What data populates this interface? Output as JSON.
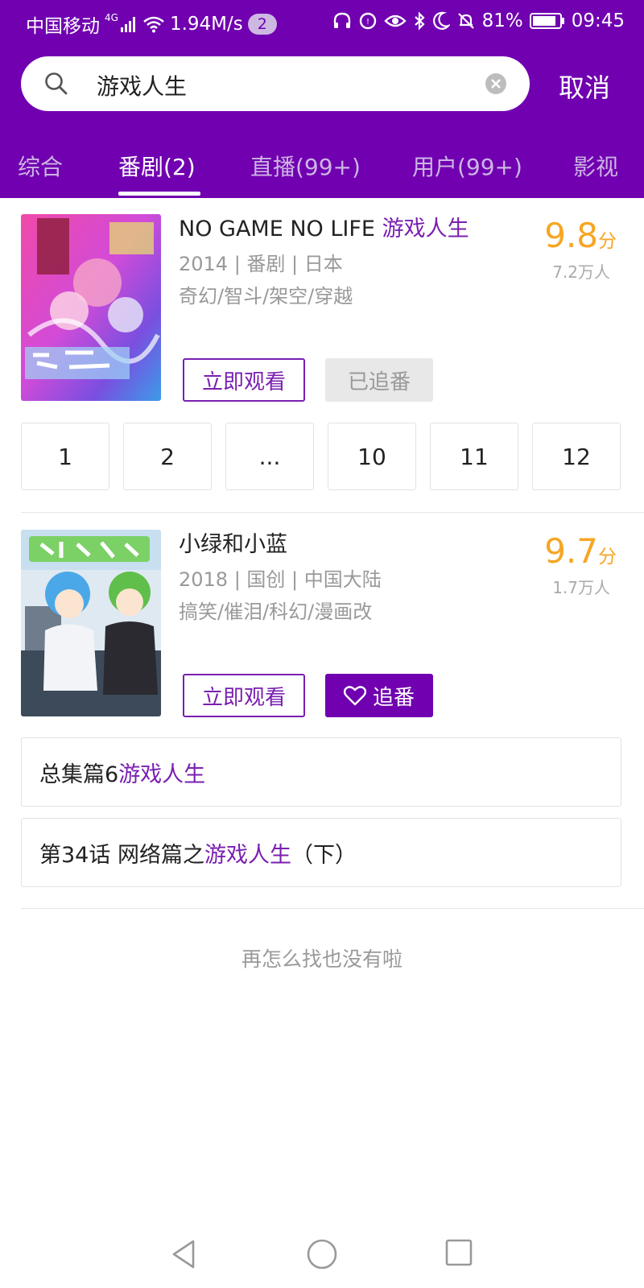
{
  "status_bar": {
    "carrier": "中国移动",
    "network": "4G",
    "speed": "1.94M/s",
    "notification_count": "2",
    "battery": "81%",
    "time": "09:45"
  },
  "search": {
    "query": "游戏人生",
    "cancel_label": "取消"
  },
  "tabs": [
    {
      "label": "综合"
    },
    {
      "label": "番剧(2)"
    },
    {
      "label": "直播(99+)"
    },
    {
      "label": "用户(99+)"
    },
    {
      "label": "影视"
    }
  ],
  "results": [
    {
      "title_prefix": "NO GAME NO LIFE ",
      "title_highlight": "游戏人生",
      "info": "2014 | 番剧 | 日本",
      "tags": "奇幻/智斗/架空/穿越",
      "score": "9.8",
      "score_unit": "分",
      "votes": "7.2万人",
      "watch_label": "立即观看",
      "follow_label": "已追番"
    },
    {
      "title_prefix": "小绿和小蓝",
      "title_highlight": "",
      "info": "2018 | 国创 | 中国大陆",
      "tags": "搞笑/催泪/科幻/漫画改",
      "score": "9.7",
      "score_unit": "分",
      "votes": "1.7万人",
      "watch_label": "立即观看",
      "follow_label": "追番"
    }
  ],
  "episodes": [
    "1",
    "2",
    "...",
    "10",
    "11",
    "12"
  ],
  "related": [
    {
      "prefix": "总集篇6 ",
      "highlight": "游戏人生",
      "suffix": ""
    },
    {
      "prefix": "第34话 网络篇之",
      "highlight": "游戏人生",
      "suffix": "（下）"
    }
  ],
  "end_message": "再怎么找也没有啦",
  "colors": {
    "brand": "#7000b0",
    "highlight": "#7a1fb0",
    "score": "#f6a623"
  }
}
